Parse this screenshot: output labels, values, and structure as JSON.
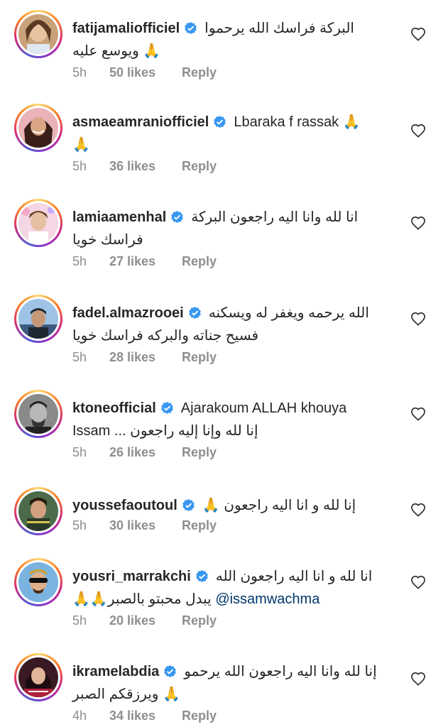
{
  "comments": [
    {
      "username": "fatijamaliofficiel",
      "line1": "البركة فراسك الله يرحموا",
      "line2": "🙏 ويوسع عليه",
      "time": "5h",
      "likes": "50 likes",
      "reply": "Reply"
    },
    {
      "username": "asmaeamraniofficiel",
      "line1": "Lbaraka f rassak 🙏",
      "line2": "🙏",
      "time": "5h",
      "likes": "36 likes",
      "reply": "Reply"
    },
    {
      "username": "lamiaamenhal",
      "line1": "انا لله وانا اليه راجعون البركة",
      "line2": "فراسك خويا",
      "time": "5h",
      "likes": "27 likes",
      "reply": "Reply"
    },
    {
      "username": "fadel.almazrooei",
      "line1": "الله يرحمه ويغفر له ويسكنه",
      "line2": "فسيح جناته والبركه فراسك خويا",
      "time": "5h",
      "likes": "28 likes",
      "reply": "Reply"
    },
    {
      "username": "ktoneofficial",
      "line1": "Ajarakoum ALLAH khouya",
      "line2": "Issam ... إنا لله وإنا إليه راجعون",
      "time": "5h",
      "likes": "26 likes",
      "reply": "Reply"
    },
    {
      "username": "youssefaoutoul",
      "line1": "إنا لله و انا اليه راجعون 🙏",
      "line2": "",
      "time": "5h",
      "likes": "30 likes",
      "reply": "Reply"
    },
    {
      "username": "yousri_marrakchi",
      "line1": "انا لله و انا اليه راجعون الله",
      "line2": "يبدل محبتو بالصبر🙏🙏",
      "mention": "@issamwachma",
      "time": "5h",
      "likes": "20 likes",
      "reply": "Reply"
    },
    {
      "username": "ikramelabdia",
      "line1": "إنا لله وانا اليه راجعون الله يرحمو",
      "line2": "🙏 ويرزقكم الصبر",
      "time": "4h",
      "likes": "34 likes",
      "reply": "Reply"
    }
  ],
  "icons": {
    "verified": "verified-badge-icon",
    "like": "heart-outline-icon"
  },
  "colors": {
    "verified": "#3897f0",
    "meta": "#8e8e8e",
    "mention": "#00376b"
  }
}
